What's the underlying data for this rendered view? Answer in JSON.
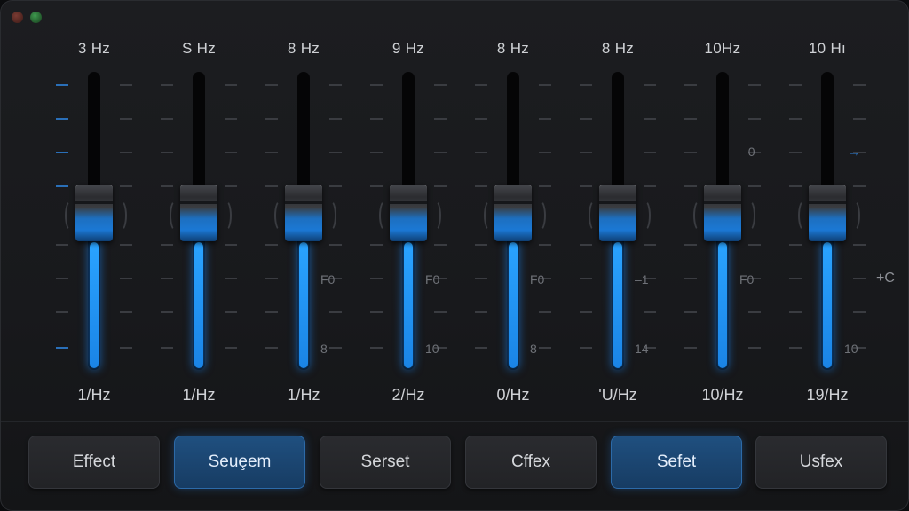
{
  "window": {
    "controls": [
      "close-button",
      "zoom-button"
    ]
  },
  "bands": [
    {
      "top_label": "3 Hz",
      "bottom_label": "1/Hz",
      "scale_a": "",
      "scale_b": ""
    },
    {
      "top_label": "S Hz",
      "bottom_label": "1/Hz",
      "scale_a": "",
      "scale_b": ""
    },
    {
      "top_label": "8 Hz",
      "bottom_label": "1/Hz",
      "scale_a": "F0",
      "scale_b": "8"
    },
    {
      "top_label": "9 Hz",
      "bottom_label": "2/Hz",
      "scale_a": "F0",
      "scale_b": "10"
    },
    {
      "top_label": "8 Hz",
      "bottom_label": "0/Hz",
      "scale_a": "F0",
      "scale_b": "8"
    },
    {
      "top_label": "8 Hz",
      "bottom_label": "'U/Hz",
      "scale_a": "–1",
      "scale_b": "14"
    },
    {
      "top_label": "10Hz",
      "bottom_label": "10/Hz",
      "scale_a": "F0",
      "scale_b": ""
    },
    {
      "top_label": "10 Hı",
      "bottom_label": "19/Hz",
      "scale_a": "",
      "scale_b": "10"
    }
  ],
  "side_labels": {
    "band7_marker": "–0",
    "band8_marker": "→",
    "right_marker": "+C"
  },
  "buttons": [
    {
      "label": "Effect",
      "active": false
    },
    {
      "label": "Seuȩem",
      "active": true
    },
    {
      "label": "Serset",
      "active": false
    },
    {
      "label": "Cffex",
      "active": false
    },
    {
      "label": "Sefet",
      "active": true
    },
    {
      "label": "Usfex",
      "active": false
    }
  ],
  "colors": {
    "accent": "#1a84e6",
    "background": "#1a1b1e",
    "active_button": "#1f4f7f"
  }
}
